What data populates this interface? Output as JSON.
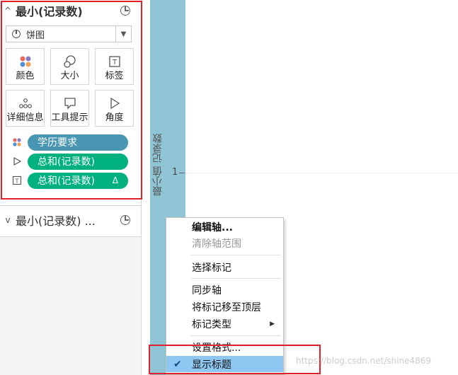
{
  "marks_card": {
    "title": "最小(记录数)",
    "mark_type": "饼图",
    "buttons": [
      {
        "label": "颜色",
        "icon": "color-dots-icon"
      },
      {
        "label": "大小",
        "icon": "size-circles-icon"
      },
      {
        "label": "标签",
        "icon": "label-t-icon"
      },
      {
        "label": "详细信息",
        "icon": "detail-dots-icon"
      },
      {
        "label": "工具提示",
        "icon": "tooltip-bubble-icon"
      },
      {
        "label": "角度",
        "icon": "angle-icon"
      }
    ],
    "pills": [
      {
        "label": "学历要求",
        "icon": "color-dots-icon",
        "color": "#4996b2"
      },
      {
        "label": "总和(记录数)",
        "icon": "angle-icon",
        "color": "#00b180"
      },
      {
        "label": "总和(记录数)",
        "icon": "label-t-icon",
        "color": "#00b180",
        "badge": "Δ"
      }
    ]
  },
  "second_card": {
    "title": "最小(记录数) ..."
  },
  "axis": {
    "title": "最小值 记录数",
    "tick": "1"
  },
  "context_menu": {
    "items": [
      {
        "label": "编辑轴...",
        "style": "bold"
      },
      {
        "label": "清除轴范围",
        "style": "disabled"
      },
      {
        "label": "选择标记",
        "style": "normal"
      },
      {
        "label": "同步轴",
        "style": "normal"
      },
      {
        "label": "将标记移至顶层",
        "style": "normal"
      },
      {
        "label": "标记类型",
        "style": "submenu"
      },
      {
        "label": "设置格式...",
        "style": "normal"
      },
      {
        "label": "显示标题",
        "style": "checked-active"
      }
    ],
    "check": "✔",
    "submenu_arrow": "▶"
  },
  "watermark": "https://blog.csdn.net/shine4869",
  "colors": {
    "accent_blue": "#4996b2",
    "accent_green": "#00b180",
    "axis_band": "#8fc5d4",
    "menu_highlight": "#8ec7f2",
    "annotation_red": "#e0202a"
  }
}
